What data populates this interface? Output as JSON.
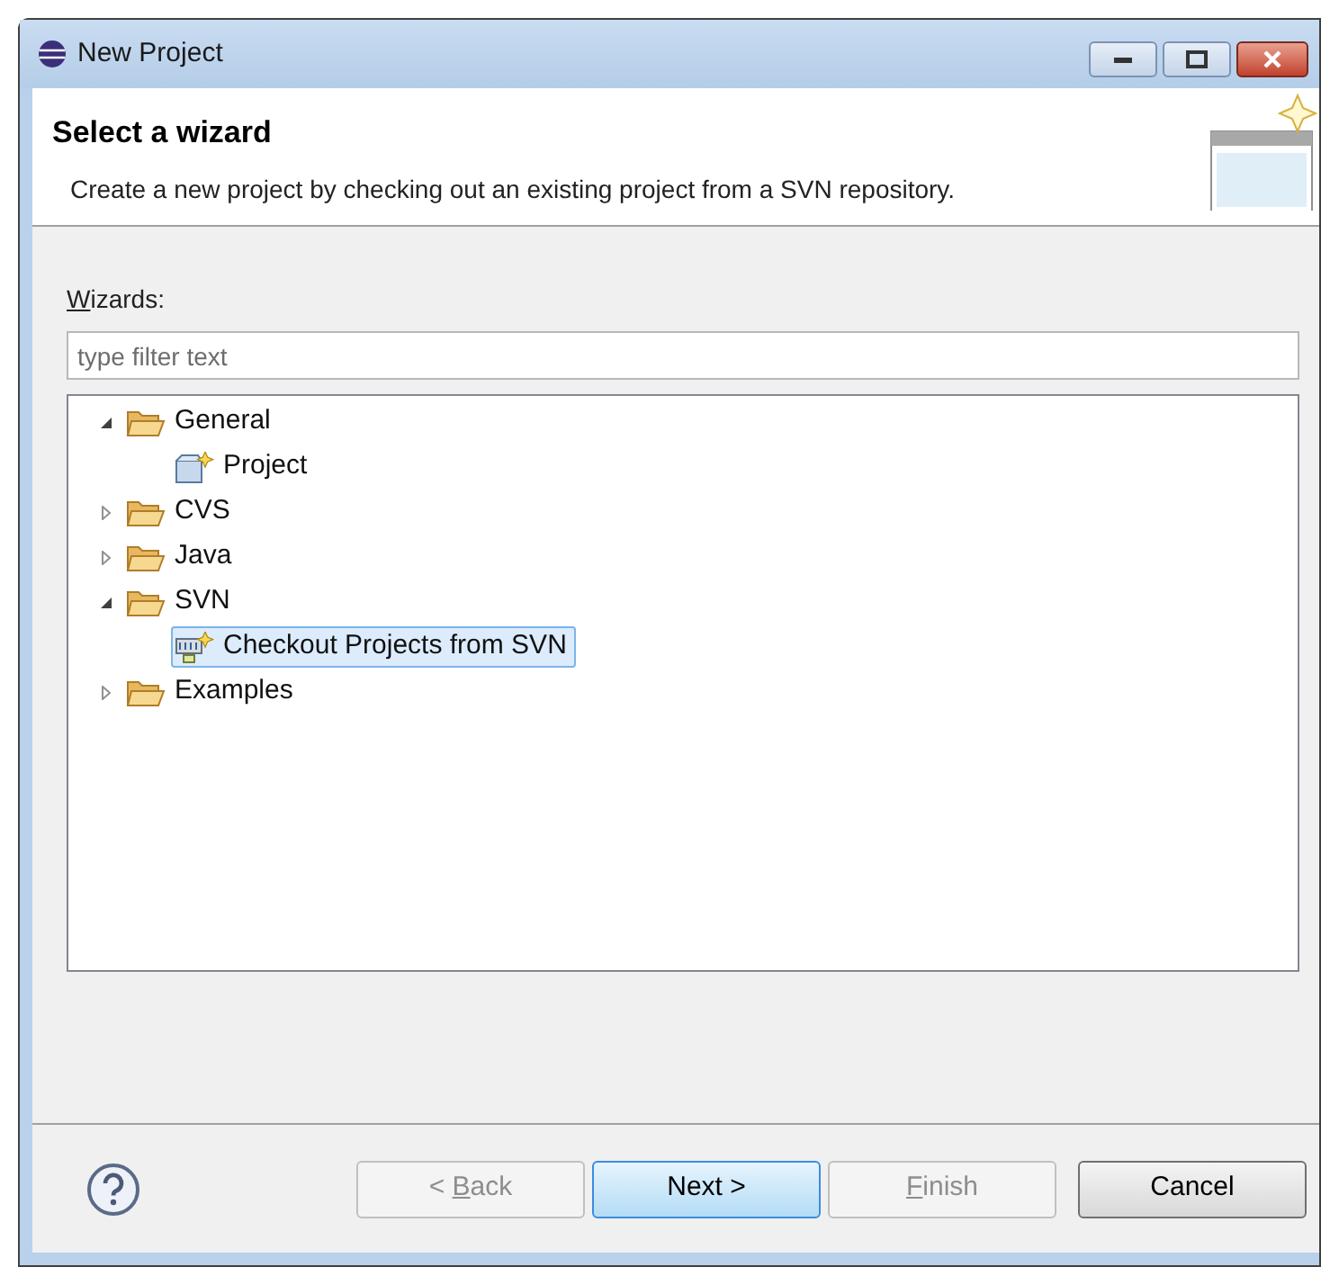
{
  "window": {
    "title": "New Project"
  },
  "header": {
    "title": "Select a wizard",
    "description": "Create a new project by checking out an existing project from a SVN repository."
  },
  "wizards_label": {
    "text": "Wizards:",
    "mnemonic_first": true
  },
  "filter": {
    "placeholder": "type filter text"
  },
  "tree": [
    {
      "label": "General",
      "kind": "folder",
      "expanded": true,
      "selected": false,
      "children": [
        {
          "label": "Project",
          "kind": "project",
          "selected": false
        }
      ]
    },
    {
      "label": "CVS",
      "kind": "folder",
      "expanded": false,
      "selected": false
    },
    {
      "label": "Java",
      "kind": "folder",
      "expanded": false,
      "selected": false
    },
    {
      "label": "SVN",
      "kind": "folder",
      "expanded": true,
      "selected": false,
      "children": [
        {
          "label": "Checkout Projects from SVN",
          "kind": "svn",
          "selected": true
        }
      ]
    },
    {
      "label": "Examples",
      "kind": "folder",
      "expanded": false,
      "selected": false
    }
  ],
  "buttons": [
    {
      "label": "< Back",
      "disabled": true,
      "default": false,
      "mnemonic_underlined": true
    },
    {
      "label": "Next >",
      "disabled": false,
      "default": true
    },
    {
      "label": "Finish",
      "disabled": true,
      "default": false,
      "mnemonic_underlined": true
    },
    {
      "label": "Cancel",
      "disabled": false,
      "default": false
    }
  ]
}
